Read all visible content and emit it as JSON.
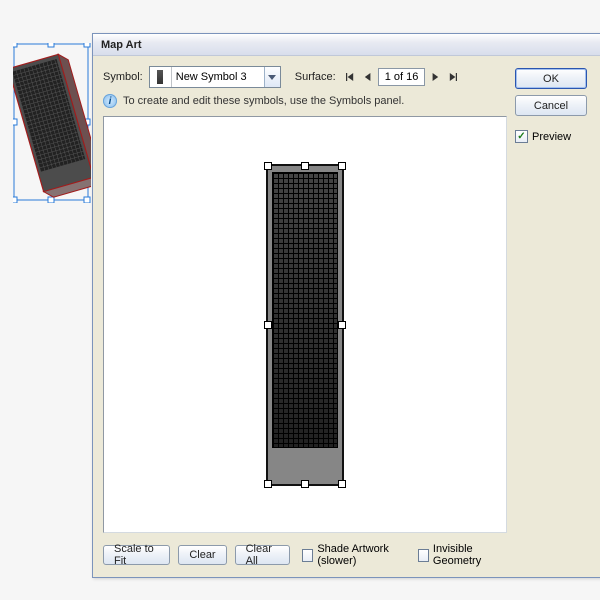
{
  "dialog": {
    "title": "Map Art",
    "symbol_label": "Symbol:",
    "symbol_value": "New Symbol 3",
    "surface_label": "Surface:",
    "surface_value": "1 of 16",
    "hint": "To create and edit these symbols, use the Symbols panel."
  },
  "buttons": {
    "ok": "OK",
    "cancel": "Cancel",
    "scale_to_fit": "Scale to Fit",
    "clear": "Clear",
    "clear_all": "Clear All"
  },
  "checkboxes": {
    "preview": "Preview",
    "shade": "Shade Artwork (slower)",
    "invisible": "Invisible Geometry"
  },
  "nav": {
    "first": "first-surface",
    "prev": "previous-surface",
    "next": "next-surface",
    "last": "last-surface"
  }
}
